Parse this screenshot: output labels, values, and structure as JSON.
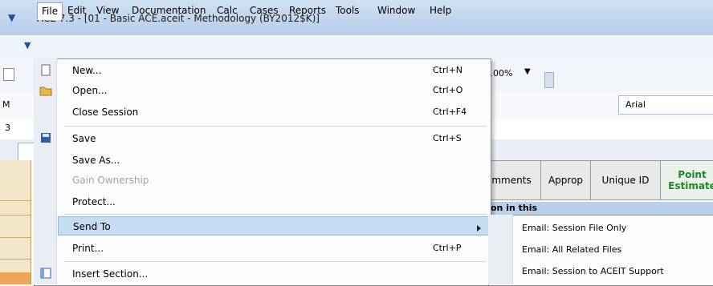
{
  "window": {
    "title": "ACE 7.3 - [01 - Basic ACE.aceit - Methodology (BY2012$K)]"
  },
  "menubar": {
    "items": [
      "File",
      "Edit",
      "View",
      "Documentation",
      "Calc",
      "Cases",
      "Reports",
      "Tools",
      "Window",
      "Help"
    ]
  },
  "toolbar": {
    "zoom": "100%",
    "font": "Arial",
    "left_fragment": "M",
    "row_fragment": "3"
  },
  "grid": {
    "headers": [
      "mments",
      "Approp",
      "Unique ID",
      "Point Estimate"
    ],
    "selected_row_text": "on in this"
  },
  "file_menu": {
    "new": {
      "label": "New...",
      "shortcut": "Ctrl+N"
    },
    "open": {
      "label": "Open...",
      "shortcut": "Ctrl+O"
    },
    "close_session": {
      "label": "Close Session",
      "shortcut": "Ctrl+F4"
    },
    "save": {
      "label": "Save",
      "shortcut": "Ctrl+S"
    },
    "save_as": {
      "label": "Save As..."
    },
    "gain_ownership": {
      "label": "Gain Ownership"
    },
    "protect": {
      "label": "Protect..."
    },
    "send_to": {
      "label": "Send To"
    },
    "print": {
      "label": "Print...",
      "shortcut": "Ctrl+P"
    },
    "insert_section": {
      "label": "Insert Section..."
    }
  },
  "send_to_menu": {
    "items": [
      "Email: Session File Only",
      "Email: All Related Files",
      "Email: Session to ACEIT Support"
    ]
  },
  "colors": {
    "highlight": "#c6dcf3",
    "title_bar": "#cfe0f3",
    "point_estimate": "#1a8a2a"
  }
}
